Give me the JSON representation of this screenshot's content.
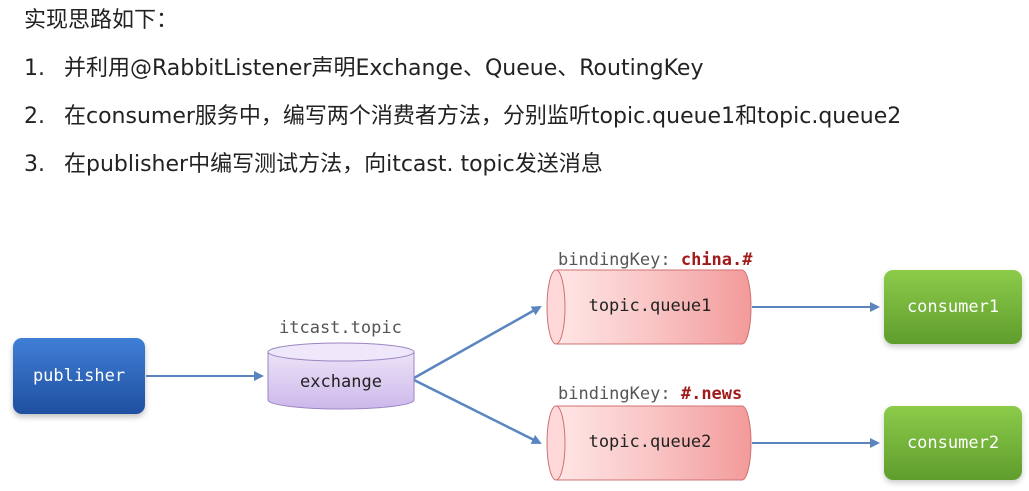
{
  "heading": "实现思路如下：",
  "steps": [
    {
      "num": "1.",
      "text": "并利用@RabbitListener声明Exchange、Queue、RoutingKey"
    },
    {
      "num": "2.",
      "text": "在consumer服务中，编写两个消费者方法，分别监听topic.queue1和topic.queue2"
    },
    {
      "num": "3.",
      "text": "在publisher中编写测试方法，向itcast. topic发送消息"
    }
  ],
  "diagram": {
    "publisher": "publisher",
    "exchange_name": "itcast.topic",
    "exchange": "exchange",
    "binding_label": "bindingKey:",
    "queue1": {
      "name": "topic.queue1",
      "binding_key": "china.#"
    },
    "queue2": {
      "name": "topic.queue2",
      "binding_key": "#.news"
    },
    "consumer1": "consumer1",
    "consumer2": "consumer2",
    "colors": {
      "publisher": "#2f66bd",
      "exchange": "#d9c8f0",
      "queue": "#f8b8b8",
      "consumer": "#78b83c",
      "arrow": "#5a85c0",
      "binding_key": "#a01c1c"
    }
  }
}
